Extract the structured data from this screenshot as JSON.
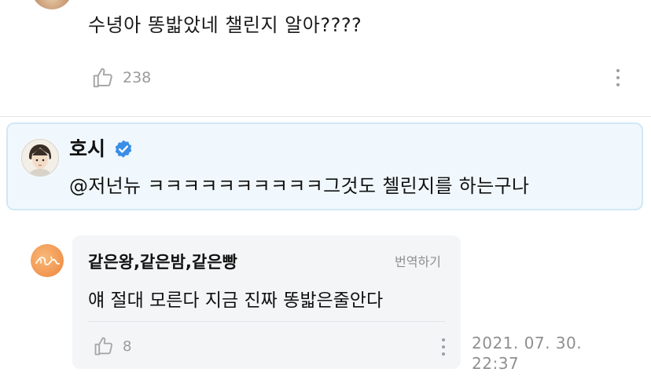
{
  "top_comment": {
    "text": "수녕아 똥밟았네 챌린지 알아????",
    "likes": "238"
  },
  "artist_reply": {
    "name": "호시",
    "text": "@저넌뉴 ㅋㅋㅋㅋㅋㅋㅋㅋㅋㅋ그것도 첼린지를 하는구나"
  },
  "fan_reply": {
    "name": "같은왕,같은밤,같은빵",
    "translate_label": "번역하기",
    "text": "얘 절대 모른다 지금 진짜 똥밟은줄안다",
    "likes": "8",
    "date": "2021. 07. 30.",
    "time": "22:37"
  },
  "icons": {
    "like": "thumbs-up-icon",
    "more": "more-vertical-icon",
    "verified": "verified-badge-icon"
  },
  "colors": {
    "verified_blue": "#3a8ee6",
    "artist_bg": "#f1f8fd",
    "card_bg": "#f4f5f7",
    "muted_text": "#9a9a9a"
  }
}
